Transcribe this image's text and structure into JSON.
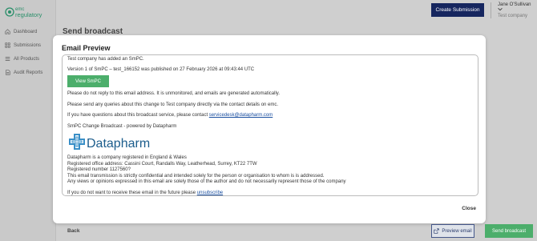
{
  "sidebar": {
    "logo_text": "emc regulatory",
    "items": [
      {
        "label": "Dashboard",
        "icon": "home-icon"
      },
      {
        "label": "Submissions",
        "icon": "grid-icon"
      },
      {
        "label": "All Products",
        "icon": "list-icon"
      },
      {
        "label": "Audit Reports",
        "icon": "document-icon"
      }
    ]
  },
  "header": {
    "create_submission": "Create Submission",
    "user_name": "Jane O'Sullivan",
    "user_company": "Test company"
  },
  "page": {
    "title": "Send broadcast"
  },
  "modal": {
    "title": "Email Preview",
    "close_label": "Close",
    "email": {
      "line1": "Test company has added an SmPC.",
      "line2": "Version 1 of SmPC – test_166152 was published on 27 February 2026 at 09:43:44 UTC",
      "view_button": "View SmPC",
      "line3": "Please do not reply to this email address. It is unmonitored, and emails are generated automatically.",
      "line4": "Please send any queries about this change to Test company directly via the contact details on emc.",
      "line5_prefix": "If you have questions about this broadcast service, please contact ",
      "line5_link": "servicedesk@datapharm.com",
      "line6": "SmPC Change Broadcast - powered by Datapharm",
      "logo_text": "Datapharm",
      "footer1": "Datapharm is a company registered in England & Wales",
      "footer2": "Registered office address: Cassini Court, Randalls Way, Leatherhead, Surrey, KT22 7TW",
      "footer3": "Registered number 1127560?",
      "footer4": "This email transmission is strictly confidential and intended solely for the person or organisation to whom is is addressed.",
      "footer5": "Any views or opinions expressed in this email are solely those of the author and do not necessarily represent those of the company",
      "unsub_prefix": "If you do not want to receive these email in the future please ",
      "unsub_link": "unsubscribe"
    }
  },
  "footer": {
    "back_label": "Back",
    "preview_email": "Preview email",
    "send_broadcast": "Send broadcast"
  },
  "colors": {
    "navy": "#16265f",
    "green": "#4cae6b",
    "link": "#1a4fa0"
  }
}
